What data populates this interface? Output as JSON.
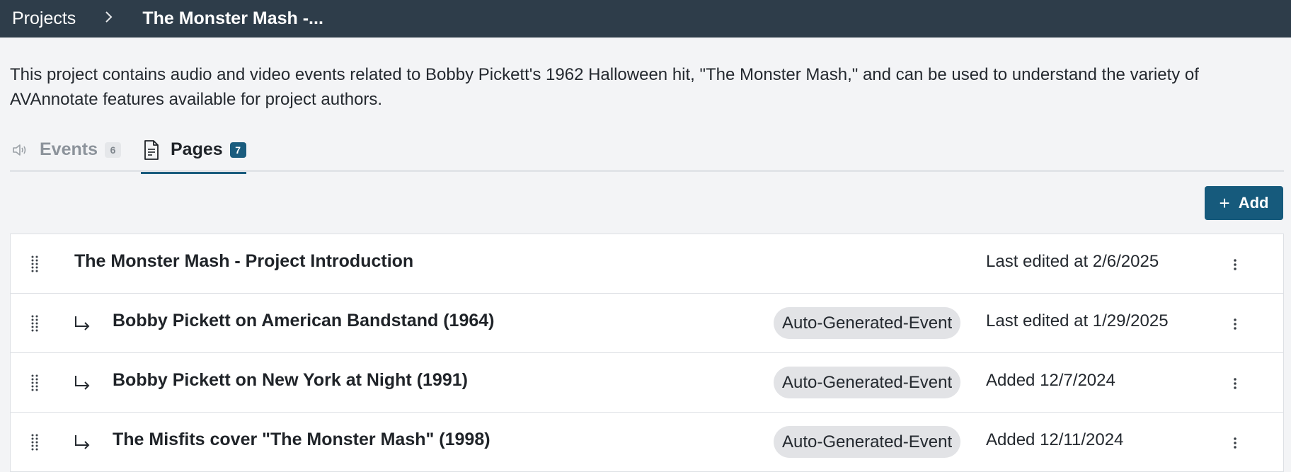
{
  "breadcrumb": {
    "root": "Projects",
    "separator": ">",
    "current": "The Monster Mash -..."
  },
  "project": {
    "description_line1": "This project contains audio and video events related to Bobby Pickett's 1962 Halloween hit, \"The Monster Mash,\" and can be used to understand the variety of",
    "description_line2": "AVAnnotate features available for project authors."
  },
  "tabs": [
    {
      "label": "Events",
      "count": "6",
      "icon": "speaker-icon",
      "active": false
    },
    {
      "label": "Pages",
      "count": "7",
      "icon": "document-icon",
      "active": true
    }
  ],
  "toolbar": {
    "add_label": "Add",
    "add_icon": "plus-icon"
  },
  "pages": [
    {
      "title": "The Monster Mash - Project Introduction",
      "tag": "",
      "meta": "Last edited at 2/6/2025",
      "child": false
    },
    {
      "title": "Bobby Pickett on American Bandstand (1964)",
      "tag": "Auto-Generated-Event",
      "meta": "Last edited at 1/29/2025",
      "child": true
    },
    {
      "title": "Bobby Pickett on New York at Night (1991)",
      "tag": "Auto-Generated-Event",
      "meta": "Added 12/7/2024",
      "child": true
    },
    {
      "title": "The Misfits cover \"The Monster Mash\" (1998)",
      "tag": "Auto-Generated-Event",
      "meta": "Added 12/11/2024",
      "child": true
    }
  ],
  "colors": {
    "topbar": "#2e3d4a",
    "accent": "#1a5c7e",
    "tag_bg": "#e2e3e6"
  }
}
